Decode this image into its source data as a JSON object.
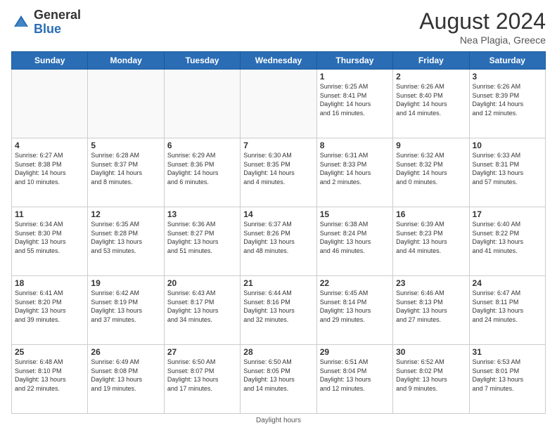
{
  "header": {
    "logo_general": "General",
    "logo_blue": "Blue",
    "month_year": "August 2024",
    "location": "Nea Plagia, Greece"
  },
  "weekdays": [
    "Sunday",
    "Monday",
    "Tuesday",
    "Wednesday",
    "Thursday",
    "Friday",
    "Saturday"
  ],
  "footer": {
    "note": "Daylight hours"
  },
  "weeks": [
    [
      {
        "day": "",
        "info": ""
      },
      {
        "day": "",
        "info": ""
      },
      {
        "day": "",
        "info": ""
      },
      {
        "day": "",
        "info": ""
      },
      {
        "day": "1",
        "info": "Sunrise: 6:25 AM\nSunset: 8:41 PM\nDaylight: 14 hours\nand 16 minutes."
      },
      {
        "day": "2",
        "info": "Sunrise: 6:26 AM\nSunset: 8:40 PM\nDaylight: 14 hours\nand 14 minutes."
      },
      {
        "day": "3",
        "info": "Sunrise: 6:26 AM\nSunset: 8:39 PM\nDaylight: 14 hours\nand 12 minutes."
      }
    ],
    [
      {
        "day": "4",
        "info": "Sunrise: 6:27 AM\nSunset: 8:38 PM\nDaylight: 14 hours\nand 10 minutes."
      },
      {
        "day": "5",
        "info": "Sunrise: 6:28 AM\nSunset: 8:37 PM\nDaylight: 14 hours\nand 8 minutes."
      },
      {
        "day": "6",
        "info": "Sunrise: 6:29 AM\nSunset: 8:36 PM\nDaylight: 14 hours\nand 6 minutes."
      },
      {
        "day": "7",
        "info": "Sunrise: 6:30 AM\nSunset: 8:35 PM\nDaylight: 14 hours\nand 4 minutes."
      },
      {
        "day": "8",
        "info": "Sunrise: 6:31 AM\nSunset: 8:33 PM\nDaylight: 14 hours\nand 2 minutes."
      },
      {
        "day": "9",
        "info": "Sunrise: 6:32 AM\nSunset: 8:32 PM\nDaylight: 14 hours\nand 0 minutes."
      },
      {
        "day": "10",
        "info": "Sunrise: 6:33 AM\nSunset: 8:31 PM\nDaylight: 13 hours\nand 57 minutes."
      }
    ],
    [
      {
        "day": "11",
        "info": "Sunrise: 6:34 AM\nSunset: 8:30 PM\nDaylight: 13 hours\nand 55 minutes."
      },
      {
        "day": "12",
        "info": "Sunrise: 6:35 AM\nSunset: 8:28 PM\nDaylight: 13 hours\nand 53 minutes."
      },
      {
        "day": "13",
        "info": "Sunrise: 6:36 AM\nSunset: 8:27 PM\nDaylight: 13 hours\nand 51 minutes."
      },
      {
        "day": "14",
        "info": "Sunrise: 6:37 AM\nSunset: 8:26 PM\nDaylight: 13 hours\nand 48 minutes."
      },
      {
        "day": "15",
        "info": "Sunrise: 6:38 AM\nSunset: 8:24 PM\nDaylight: 13 hours\nand 46 minutes."
      },
      {
        "day": "16",
        "info": "Sunrise: 6:39 AM\nSunset: 8:23 PM\nDaylight: 13 hours\nand 44 minutes."
      },
      {
        "day": "17",
        "info": "Sunrise: 6:40 AM\nSunset: 8:22 PM\nDaylight: 13 hours\nand 41 minutes."
      }
    ],
    [
      {
        "day": "18",
        "info": "Sunrise: 6:41 AM\nSunset: 8:20 PM\nDaylight: 13 hours\nand 39 minutes."
      },
      {
        "day": "19",
        "info": "Sunrise: 6:42 AM\nSunset: 8:19 PM\nDaylight: 13 hours\nand 37 minutes."
      },
      {
        "day": "20",
        "info": "Sunrise: 6:43 AM\nSunset: 8:17 PM\nDaylight: 13 hours\nand 34 minutes."
      },
      {
        "day": "21",
        "info": "Sunrise: 6:44 AM\nSunset: 8:16 PM\nDaylight: 13 hours\nand 32 minutes."
      },
      {
        "day": "22",
        "info": "Sunrise: 6:45 AM\nSunset: 8:14 PM\nDaylight: 13 hours\nand 29 minutes."
      },
      {
        "day": "23",
        "info": "Sunrise: 6:46 AM\nSunset: 8:13 PM\nDaylight: 13 hours\nand 27 minutes."
      },
      {
        "day": "24",
        "info": "Sunrise: 6:47 AM\nSunset: 8:11 PM\nDaylight: 13 hours\nand 24 minutes."
      }
    ],
    [
      {
        "day": "25",
        "info": "Sunrise: 6:48 AM\nSunset: 8:10 PM\nDaylight: 13 hours\nand 22 minutes."
      },
      {
        "day": "26",
        "info": "Sunrise: 6:49 AM\nSunset: 8:08 PM\nDaylight: 13 hours\nand 19 minutes."
      },
      {
        "day": "27",
        "info": "Sunrise: 6:50 AM\nSunset: 8:07 PM\nDaylight: 13 hours\nand 17 minutes."
      },
      {
        "day": "28",
        "info": "Sunrise: 6:50 AM\nSunset: 8:05 PM\nDaylight: 13 hours\nand 14 minutes."
      },
      {
        "day": "29",
        "info": "Sunrise: 6:51 AM\nSunset: 8:04 PM\nDaylight: 13 hours\nand 12 minutes."
      },
      {
        "day": "30",
        "info": "Sunrise: 6:52 AM\nSunset: 8:02 PM\nDaylight: 13 hours\nand 9 minutes."
      },
      {
        "day": "31",
        "info": "Sunrise: 6:53 AM\nSunset: 8:01 PM\nDaylight: 13 hours\nand 7 minutes."
      }
    ]
  ]
}
